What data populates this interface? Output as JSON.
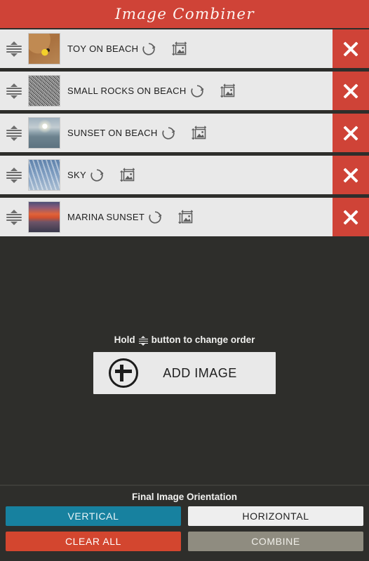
{
  "app": {
    "title": "Image Combiner",
    "colors": {
      "header_red": "#cf4337",
      "background_dark": "#2e2e2b",
      "row_light": "#e9e9e9",
      "accent_blue": "#17819f",
      "clear_red": "#d3462f",
      "combine_gray": "#8f8c80"
    }
  },
  "list": {
    "rows": [
      {
        "label": "TOY ON BEACH",
        "thumb": "thumb-toy",
        "drag_icon": "drag-handle-icon",
        "rotate_icon": "rotate-icon",
        "resize_icon": "resize-image-icon",
        "delete_icon": "close-x-icon"
      },
      {
        "label": "SMALL ROCKS ON BEACH",
        "thumb": "thumb-rocks",
        "drag_icon": "drag-handle-icon",
        "rotate_icon": "rotate-icon",
        "resize_icon": "resize-image-icon",
        "delete_icon": "close-x-icon"
      },
      {
        "label": "SUNSET ON BEACH",
        "thumb": "thumb-sunset-beach",
        "drag_icon": "drag-handle-icon",
        "rotate_icon": "rotate-icon",
        "resize_icon": "resize-image-icon",
        "delete_icon": "close-x-icon"
      },
      {
        "label": "SKY",
        "thumb": "thumb-sky",
        "drag_icon": "drag-handle-icon",
        "rotate_icon": "rotate-icon",
        "resize_icon": "resize-image-icon",
        "delete_icon": "close-x-icon"
      },
      {
        "label": "MARINA SUNSET",
        "thumb": "thumb-marina",
        "drag_icon": "drag-handle-icon",
        "rotate_icon": "rotate-icon",
        "resize_icon": "resize-image-icon",
        "delete_icon": "close-x-icon"
      }
    ]
  },
  "hint": {
    "before": "Hold",
    "after": "button to change order",
    "icon": "drag-handle-icon"
  },
  "add_image": {
    "label": "ADD IMAGE",
    "icon": "plus-circle-icon"
  },
  "bottom": {
    "orientation_label": "Final Image Orientation",
    "vertical_label": "VERTICAL",
    "horizontal_label": "HORIZONTAL",
    "clear_all_label": "CLEAR ALL",
    "combine_label": "COMBINE",
    "selected_orientation": "VERTICAL"
  }
}
